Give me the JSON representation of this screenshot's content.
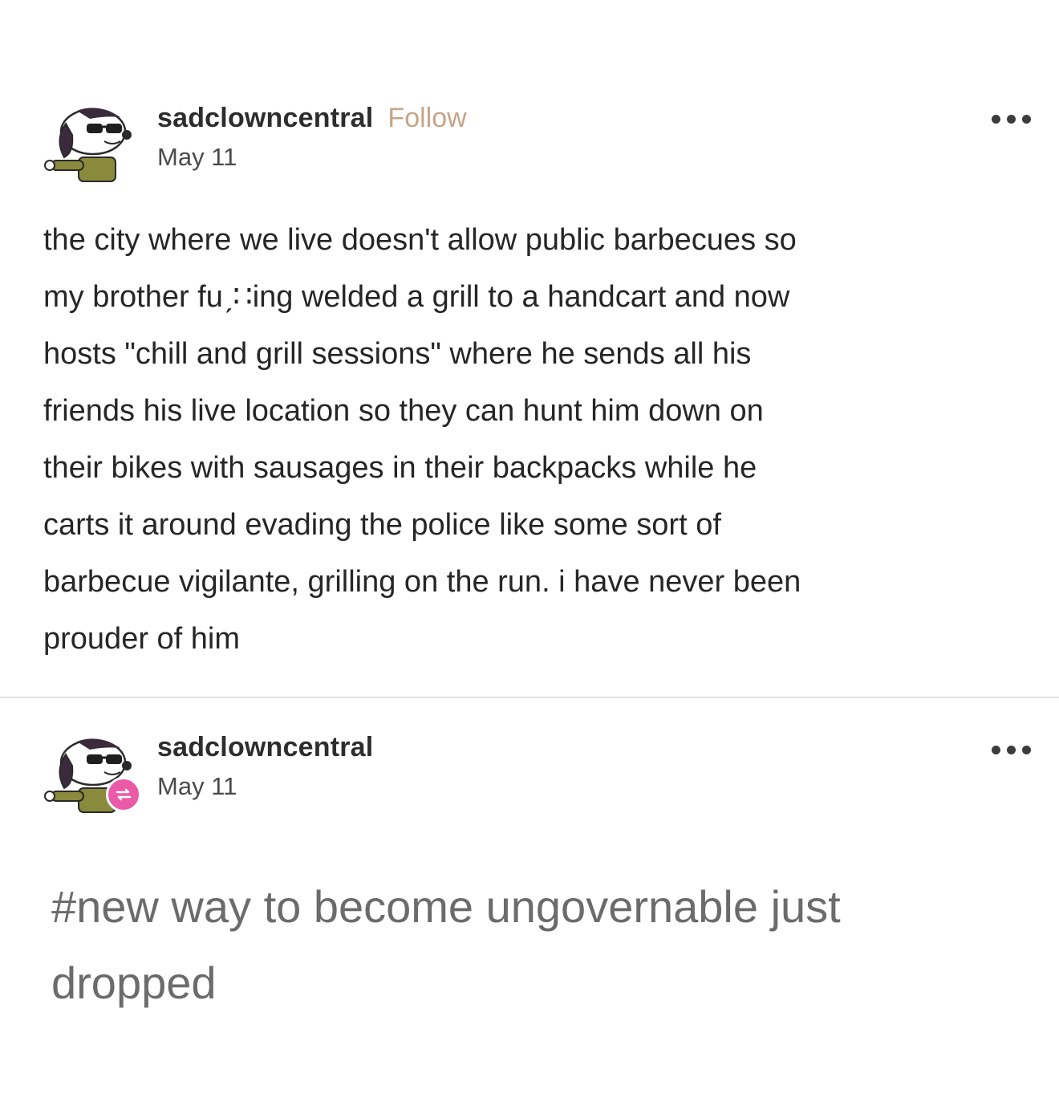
{
  "post": {
    "username": "sadclowncentral",
    "follow_label": "Follow",
    "date": "May 11",
    "body_lines": [
      "the city where we live doesn't allow public barbecues so",
      "my brother fuˏ∷ing welded a grill to a handcart and now",
      "hosts \"chill and grill sessions\" where he sends all his",
      "friends his live location so they can hunt him down on",
      "their bikes with sausages in their backpacks while he",
      "carts it around evading the police like some sort of",
      "barbecue vigilante, grilling on the run. i have never been",
      "prouder of him"
    ]
  },
  "reblog": {
    "username": "sadclowncentral",
    "date": "May 11",
    "tag_lines": [
      "#new way to become ungovernable just",
      "dropped"
    ]
  },
  "colors": {
    "follow": "#c8a487",
    "reblog_badge": "#ea5aa6",
    "tags_text": "#6b6b6b"
  },
  "icons": {
    "more_menu": "more-options-icon",
    "reblog": "reblog-icon",
    "avatar": "clown-dog-avatar"
  }
}
